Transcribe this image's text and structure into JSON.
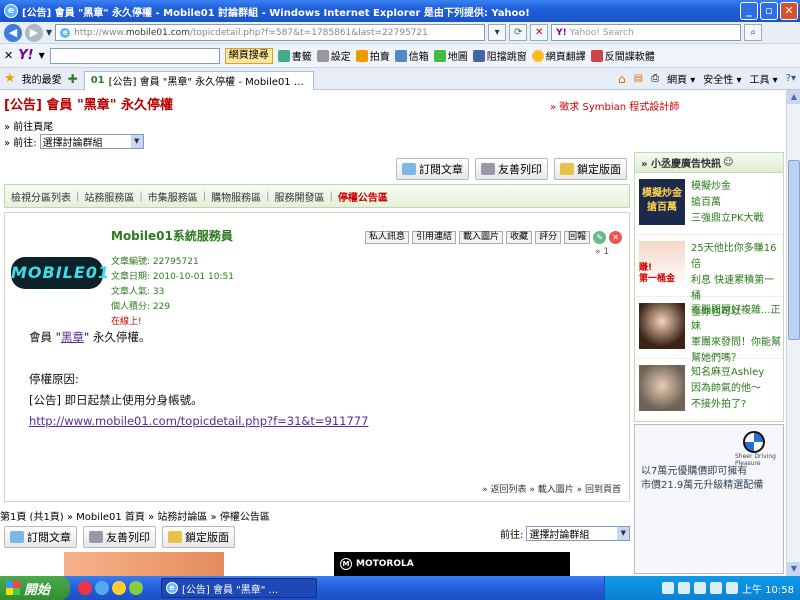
{
  "window": {
    "title": "[公告] 會員 \"黑章\" 永久停權 - Mobile01 討論群組 - Windows Internet Explorer 是由下列提供: Yahoo!"
  },
  "address": {
    "url_prefix": "http://www.",
    "url_domain": "mobile01.com",
    "url_path": "/topicdetail.php?f=587&t=1785861&last=22795721",
    "search_placeholder": "Yahoo! Search"
  },
  "yahoo_toolbar": {
    "logo": "Y!",
    "search_button": "網頁搜尋",
    "items": [
      "書籤",
      "設定",
      "拍賣",
      "信箱",
      "地圖",
      "阻擋跳窗",
      "網頁翻譯",
      "反間諜軟體"
    ]
  },
  "favorites_bar": {
    "favorites_label": "我的最愛",
    "tab_title": "[公告] 會員 \"黑章\" 永久停權 - Mobile01 討論群組",
    "tools": [
      "網頁",
      "安全性",
      "工具"
    ]
  },
  "page": {
    "announce_tag": "[公告]",
    "announce_title": "會員 \"黑章\" 永久停權",
    "symbian_link": "» 徵求 Symbian 程式設計師",
    "to_footer": "» 前往頁尾",
    "goto_label": "» 前往:",
    "goto_select": "選擇討論群組",
    "action_buttons": [
      "訂閱文章",
      "友善列印",
      "鎖定版面"
    ],
    "breadcrumbs": [
      "檢視分區列表",
      "站務服務區",
      "市集服務區",
      "購物服務區",
      "服務開發區",
      "停權公告區"
    ],
    "post": {
      "username": "Mobile01系統服務員",
      "buttons": [
        "私人訊息",
        "引用連結",
        "載入圖片",
        "收藏",
        "評分",
        "回報"
      ],
      "post_number": "» 1",
      "logo_text": "MOBILE01",
      "article_id": "文章編號: 22795721",
      "article_date": "文章日期: 2010-10-01 10:51",
      "article_views": "文章人氣: 33",
      "user_score": "個人積分: 229",
      "online": "在線上!",
      "body_prefix": "會員 \"",
      "body_link": "黑章",
      "body_suffix": "\" 永久停權。",
      "reason_label": "停權原因:",
      "reason_text": "[公告] 即日起禁止使用分身帳號。",
      "link_url": "http://www.mobile01.com/topicdetail.php?f=31&t=911777",
      "footer": "» 返回列表 » 載入圖片 » 回到頁首"
    },
    "pager": "第1頁 (共1頁) » Mobile01 首頁 » 站務討論區 » 停權公告區",
    "bottom_goto_label": "前往:",
    "bottom_goto_select": "選擇討論群組",
    "motorola": "MOTOROLA"
  },
  "sidebar": {
    "header": "» 小丞慶廣告快訊",
    "ads": [
      {
        "thumb_text": "模擬炒金\n搶百萬",
        "line1": "模擬炒金",
        "line2": "搶百萬",
        "line3": "三強鼎立PK大戰"
      },
      {
        "thumb_text": "賺!\n第一桶金",
        "line1": "25天他比你多賺16倍",
        "line2": "利息 快速累積第一桶",
        "line3": "金你也可以"
      },
      {
        "thumb_text": "",
        "line1": "電腦問題好複雜...正妹",
        "line2": "軍團來發問！你能幫",
        "line3": "幫她們嗎？"
      },
      {
        "thumb_text": "",
        "line1": "知名麻豆Ashley",
        "line2": "因為帥氣的他～",
        "line3": "不接外拍了?"
      }
    ],
    "bmw": {
      "tagline": "Sheer Driving Pleasure",
      "line1": "以7萬元優購價即可擁有",
      "line2": "市價21.9萬元升級精選配備"
    }
  },
  "taskbar": {
    "start": "開始",
    "task": "[公告] 會員 \"黑章\" ...",
    "time": "上午 10:58"
  },
  "colors": {
    "title_red": "#bb0000",
    "green_text": "#2b7a1c",
    "link_purple": "#5b2a9a"
  }
}
